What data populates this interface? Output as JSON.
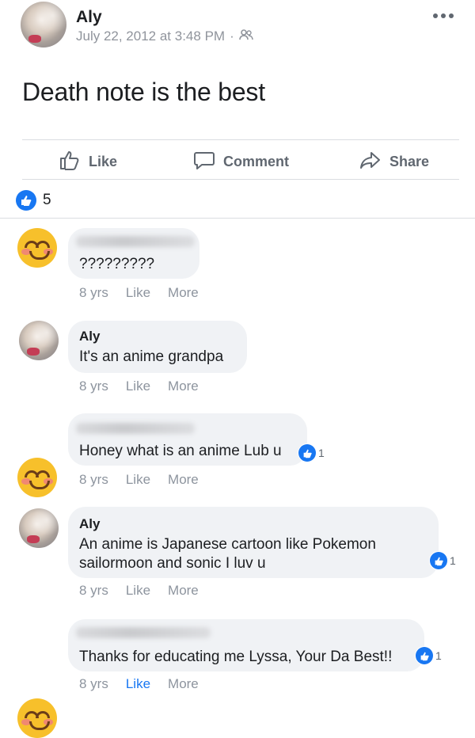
{
  "post": {
    "author": "Aly",
    "timestamp": "July 22, 2012 at 3:48 PM",
    "separator": "·",
    "audience_icon": "friends-icon",
    "text": "Death note is the best",
    "more_icon": "ellipsis-icon"
  },
  "actions": {
    "like": "Like",
    "comment": "Comment",
    "share": "Share"
  },
  "reactions": {
    "count": "5",
    "type": "like"
  },
  "comments": [
    {
      "author": "",
      "text": "?????????",
      "age": "8 yrs",
      "like": "Like",
      "more": "More",
      "avatar": "blushing-smile-emoji"
    },
    {
      "author": "Aly",
      "text": "It's an anime grandpa",
      "age": "8 yrs",
      "like": "Like",
      "more": "More",
      "avatar": "photo"
    },
    {
      "author": "",
      "text": "Honey what is an anime Lub u",
      "age": "8 yrs",
      "like": "Like",
      "more": "More",
      "reaction_count": "1",
      "avatar": "blushing-smile-emoji"
    },
    {
      "author": "Aly",
      "text": "An anime is Japanese cartoon like Pokemon sailormoon and sonic I luv u",
      "age": "8 yrs",
      "like": "Like",
      "more": "More",
      "reaction_count": "1",
      "avatar": "photo"
    },
    {
      "author": "",
      "text": "Thanks for educating me Lyssa, Your Da Best!!",
      "age": "8 yrs",
      "like": "Like",
      "more": "More",
      "reaction_count": "1",
      "liked": true,
      "avatar": "blushing-smile-emoji"
    }
  ],
  "colors": {
    "like_blue": "#1877f2",
    "bubble": "#f0f2f5",
    "meta_gray": "#8d949e"
  }
}
